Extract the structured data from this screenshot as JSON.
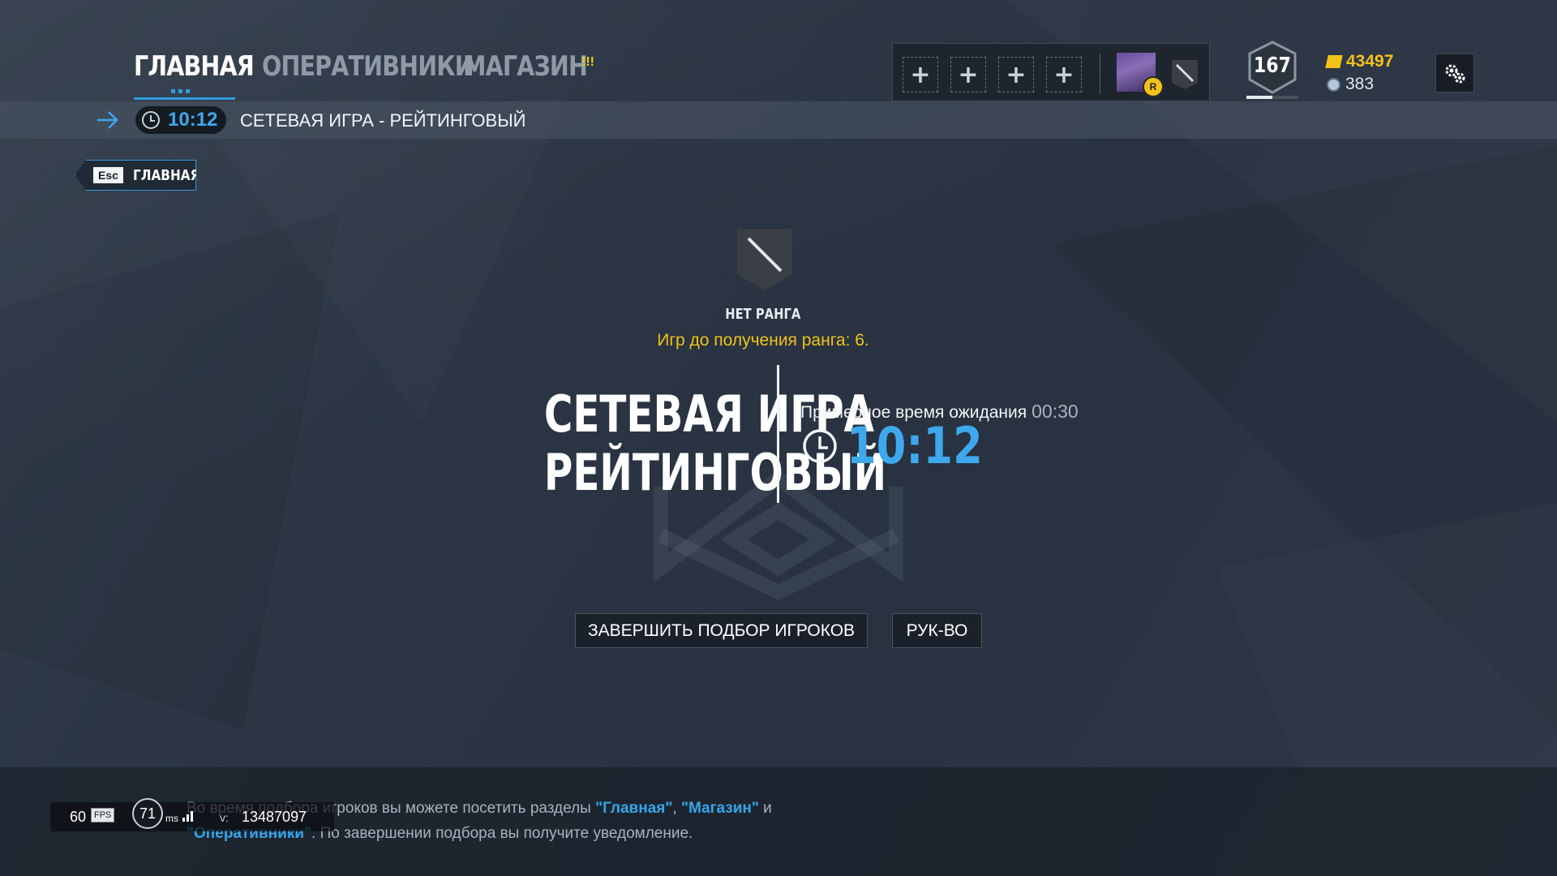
{
  "nav": {
    "tabs": [
      {
        "label": "ГЛАВНАЯ",
        "active": true
      },
      {
        "label": "ОПЕРАТИВНИКИ",
        "active": false
      },
      {
        "label": "МАГАЗИН",
        "active": false
      }
    ],
    "shop_badge": "!!!"
  },
  "squad": {
    "slots": [
      "+",
      "+",
      "+",
      "+"
    ],
    "avatar_badge": "R"
  },
  "player": {
    "level": "167",
    "level_progress": 0.5
  },
  "currency": {
    "renown": "43497",
    "credits": "383"
  },
  "status": {
    "timer": "10:12",
    "mode": "СЕТЕВАЯ ИГРА - РЕЙТИНГОВЫЙ"
  },
  "back": {
    "key": "Esc",
    "label": "ГЛАВНАЯ"
  },
  "rank": {
    "name": "НЕТ РАНГА",
    "games_left": "Игр до получения ранга: 6."
  },
  "mode": {
    "title_line1": "СЕТЕВАЯ ИГРА",
    "title_line2": "РЕЙТИНГОВЫЙ",
    "wait_label": "Примерное время ожидания",
    "wait_value": "00:30",
    "timer": "10:12"
  },
  "buttons": {
    "end_matchmaking": "ЗАВЕРШИТЬ ПОДБОР ИГРОКОВ",
    "guide": "РУК-ВО"
  },
  "tip": {
    "part1": "Во время подбора игроков вы можете посетить разделы ",
    "link_main": "\"Главная\"",
    "sep": ", ",
    "link_shop": "\"Магазин\"",
    "part2": " и ",
    "link_ops": "\"Оперативники\"",
    "part3": ". По завершении подбора вы получите уведомление."
  },
  "perf": {
    "fps": "60",
    "fps_tag": "FPS",
    "ping": "71",
    "ping_unit": "ms",
    "version_label": "v:",
    "version": "13487097"
  },
  "colors": {
    "accent_blue": "#3ea8ec",
    "accent_yellow": "#f2c21a"
  }
}
